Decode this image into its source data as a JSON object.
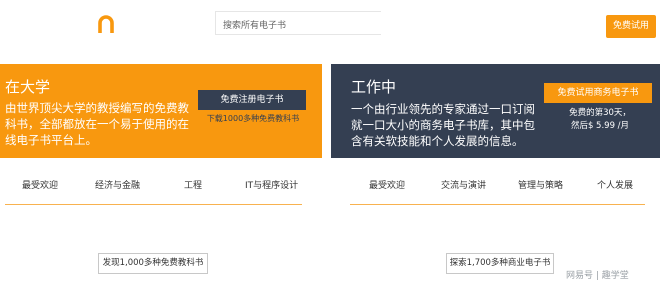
{
  "header": {
    "search_placeholder": "搜索所有电子书",
    "trial_label": "免费试用"
  },
  "left_panel": {
    "title": "在大学",
    "description": "由世界顶尖大学的教授编写的免费教科书，全部都放在一个易于使用的在线电子书平台上。",
    "button_label": "免费注册电子书",
    "subtext": "下载1000多种免费教科书"
  },
  "right_panel": {
    "title": "工作中",
    "description": "一个由行业领先的专家通过一口订阅就一口大小的商务电子书库，其中包含有关软技能和个人发展的信息。",
    "button_label": "免费试用商务电子书",
    "price_line1": "免费的第30天，",
    "price_line2": "然后$ 5.99 /月"
  },
  "left_tabs": [
    "最受欢迎",
    "经济与金融",
    "工程",
    "IT与程序设计"
  ],
  "right_tabs": [
    "最受欢迎",
    "交流与演讲",
    "管理与策略",
    "个人发展"
  ],
  "bottom": {
    "left_button": "发现1,000多种免费教科书",
    "right_button": "探索1,700多种商业电子书"
  },
  "watermark": "网易号 | 趣学堂",
  "colors": {
    "accent_orange": "#f8980f",
    "navy": "#343f52"
  }
}
